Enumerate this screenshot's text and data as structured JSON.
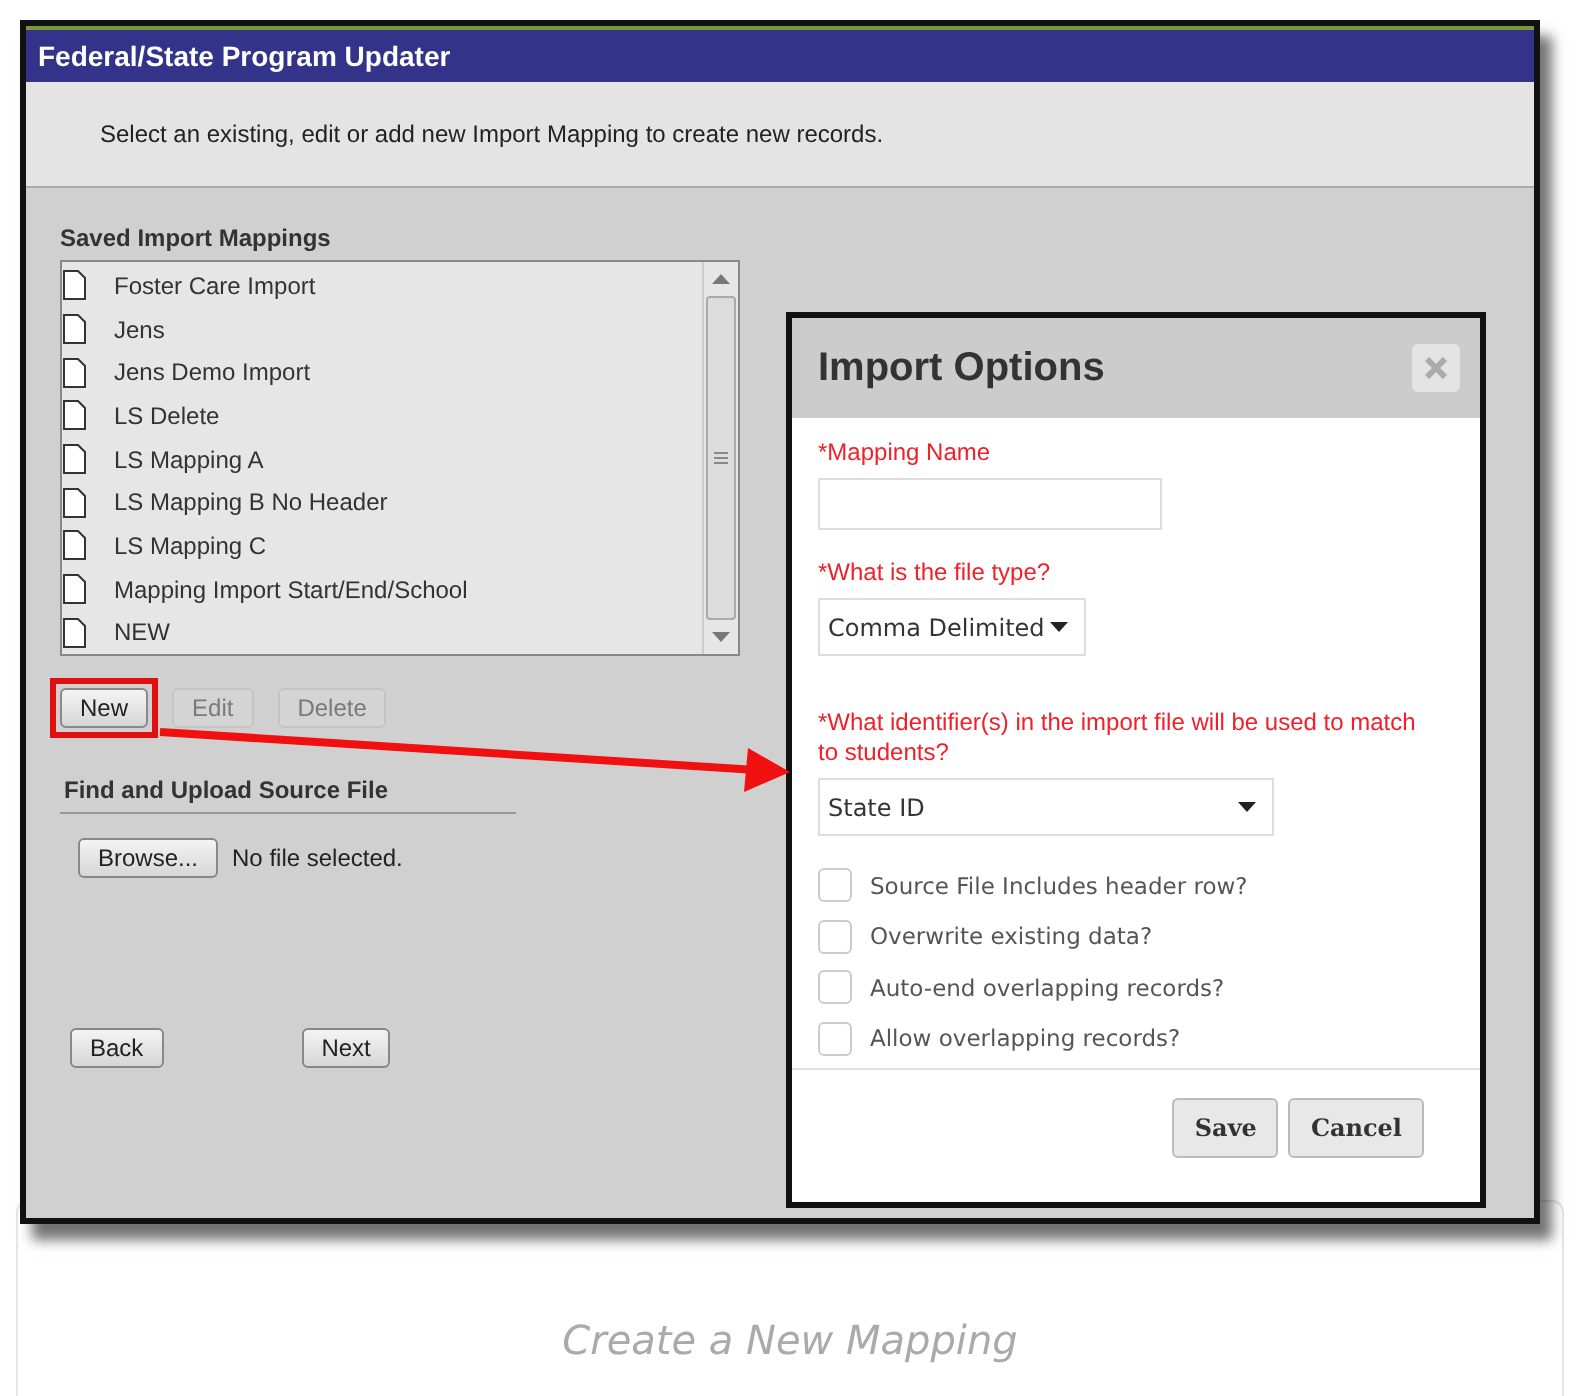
{
  "window": {
    "title": "Federal/State Program Updater"
  },
  "instruction": "Select an existing, edit or add new Import Mapping to create new records.",
  "saved_mappings": {
    "heading": "Saved Import Mappings",
    "items": [
      {
        "label": "Foster Care Import"
      },
      {
        "label": "Jens"
      },
      {
        "label": "Jens Demo Import"
      },
      {
        "label": "LS Delete"
      },
      {
        "label": "LS Mapping A"
      },
      {
        "label": "LS Mapping B No Header"
      },
      {
        "label": "LS Mapping C"
      },
      {
        "label": "Mapping Import Start/End/School"
      },
      {
        "label": "NEW"
      }
    ],
    "buttons": [
      {
        "label": "New",
        "disabled": false,
        "highlighted": true
      },
      {
        "label": "Edit",
        "disabled": true,
        "highlighted": false
      },
      {
        "label": "Delete",
        "disabled": true,
        "highlighted": false
      }
    ]
  },
  "upload": {
    "heading": "Find and Upload Source File",
    "browse_button": "Browse...",
    "file_status": "No file selected."
  },
  "nav_buttons": [
    {
      "label": "Back"
    },
    {
      "label": "Next"
    }
  ],
  "dialog": {
    "title": "Import Options",
    "fields": [
      {
        "kind": "text",
        "label": "*Mapping Name"
      },
      {
        "kind": "select",
        "label": "*What is the file type?",
        "value": "Comma Delimited",
        "wide": false
      },
      {
        "kind": "select",
        "label": "*What identifier(s) in the import file will be used to match to students?",
        "value": "State ID",
        "wide": true
      }
    ],
    "checkboxes": [
      {
        "label": "Source File Includes header row?",
        "checked": false
      },
      {
        "label": "Overwrite existing data?",
        "checked": false
      },
      {
        "label": "Auto-end overlapping records?",
        "checked": false
      },
      {
        "label": "Allow overlapping records?",
        "checked": false
      }
    ],
    "buttons": [
      "Save",
      "Cancel"
    ]
  },
  "caption": "Create a New Mapping"
}
